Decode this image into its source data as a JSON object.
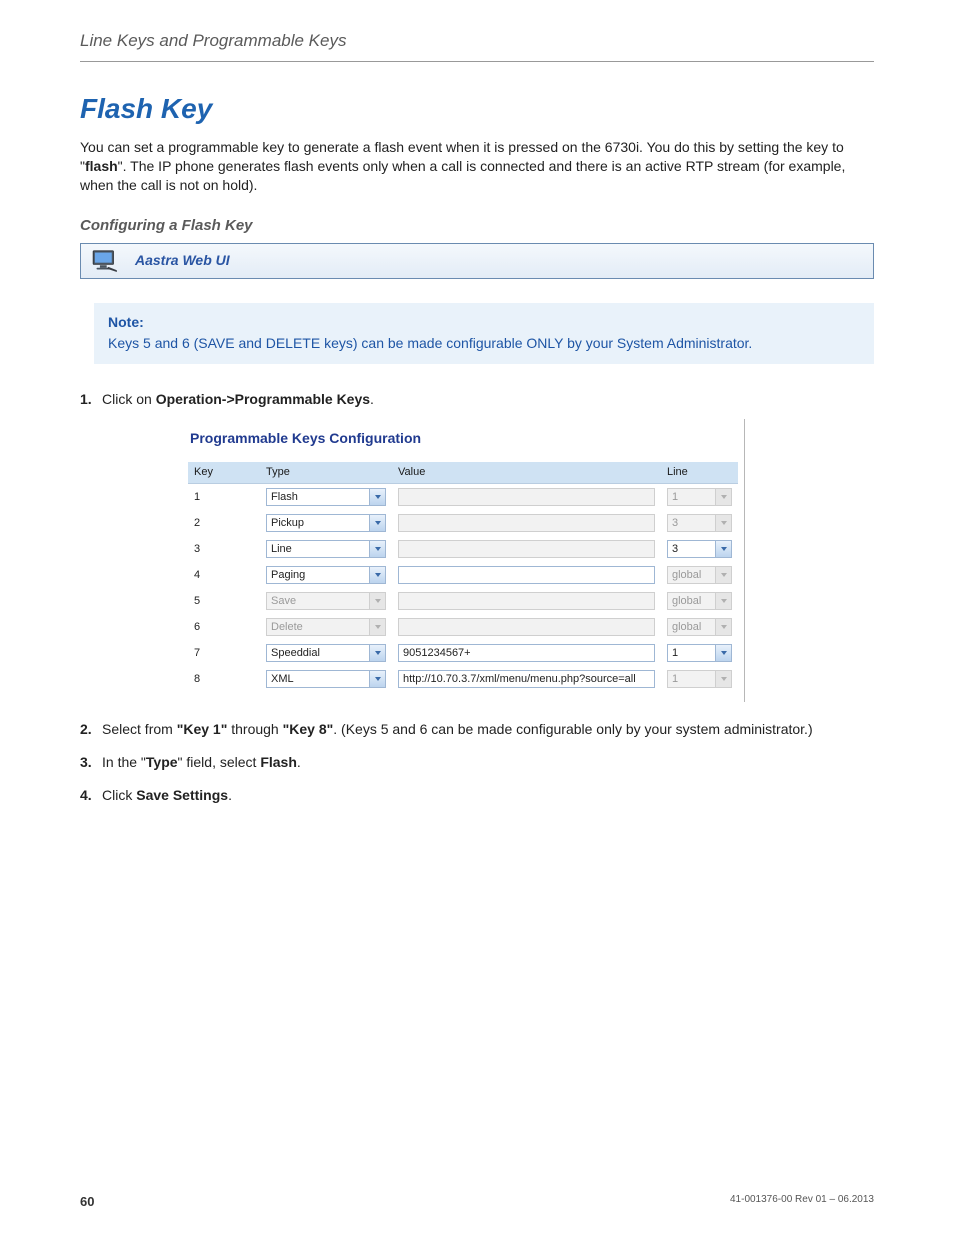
{
  "header": {
    "running": "Line Keys and Programmable Keys"
  },
  "title": "Flash Key",
  "intro": {
    "p1a": "You can set a programmable key to generate a flash event when it is pressed on the 6730i. You do this by setting the key to \"",
    "p1_bold": "flash",
    "p1b": "\". The IP phone generates flash events only when a call is connected and there is an active RTP stream (for example, when the call is not on hold)."
  },
  "subheading": "Configuring a Flash Key",
  "webui_label": "Aastra Web UI",
  "note": {
    "label": "Note:",
    "text": "Keys 5 and 6 (SAVE and DELETE keys) can be made configurable ONLY by your System Administrator."
  },
  "steps": {
    "s1": {
      "num": "1.",
      "a": "Click on ",
      "b": "Operation->Programmable Keys",
      "c": "."
    },
    "s2": {
      "num": "2.",
      "a": "Select from ",
      "b": "\"Key 1\"",
      "c": " through ",
      "d": "\"Key 8\"",
      "e": ". (Keys 5 and 6 can be made configurable only by your system administrator.)"
    },
    "s3": {
      "num": "3.",
      "a": "In the \"",
      "b": "Type",
      "c": "\" field, select ",
      "d": "Flash",
      "e": "."
    },
    "s4": {
      "num": "4.",
      "a": "Click ",
      "b": "Save Settings",
      "c": "."
    }
  },
  "screenshot": {
    "title": "Programmable Keys Configuration",
    "headers": {
      "key": "Key",
      "type": "Type",
      "value": "Value",
      "line": "Line"
    },
    "rows": [
      {
        "key": "1",
        "type": "Flash",
        "value": "",
        "line": "1",
        "type_enabled": true,
        "value_enabled": false,
        "line_enabled": false
      },
      {
        "key": "2",
        "type": "Pickup",
        "value": "",
        "line": "3",
        "type_enabled": true,
        "value_enabled": false,
        "line_enabled": false
      },
      {
        "key": "3",
        "type": "Line",
        "value": "",
        "line": "3",
        "type_enabled": true,
        "value_enabled": false,
        "line_enabled": true
      },
      {
        "key": "4",
        "type": "Paging",
        "value": "",
        "line": "global",
        "type_enabled": true,
        "value_enabled": true,
        "line_enabled": false
      },
      {
        "key": "5",
        "type": "Save",
        "value": "",
        "line": "global",
        "type_enabled": false,
        "value_enabled": false,
        "line_enabled": false
      },
      {
        "key": "6",
        "type": "Delete",
        "value": "",
        "line": "global",
        "type_enabled": false,
        "value_enabled": false,
        "line_enabled": false
      },
      {
        "key": "7",
        "type": "Speeddial",
        "value": "9051234567+",
        "line": "1",
        "type_enabled": true,
        "value_enabled": true,
        "line_enabled": true
      },
      {
        "key": "8",
        "type": "XML",
        "value": "http://10.70.3.7/xml/menu/menu.php?source=all",
        "line": "1",
        "type_enabled": true,
        "value_enabled": true,
        "line_enabled": false
      }
    ]
  },
  "footer": {
    "page": "60",
    "doc": "41-001376-00 Rev 01 – 06.2013"
  }
}
